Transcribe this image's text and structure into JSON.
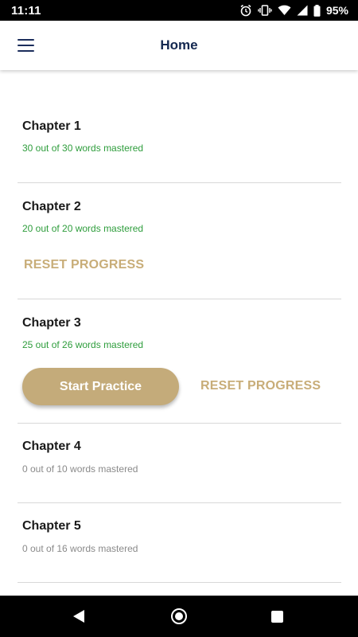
{
  "status_bar": {
    "time": "11:11",
    "battery": "95%"
  },
  "app_bar": {
    "title": "Home"
  },
  "chapters": [
    {
      "title": "Chapter 1",
      "subtitle": "30 out of 30 words mastered"
    },
    {
      "title": "Chapter 2",
      "subtitle": "20 out of 20 words mastered",
      "reset_label": "RESET PROGRESS"
    },
    {
      "title": "Chapter 3",
      "subtitle": "25 out of 26 words mastered",
      "start_label": "Start Practice",
      "reset_label": "RESET PROGRESS"
    },
    {
      "title": "Chapter 4",
      "subtitle": "0 out of 10 words mastered"
    },
    {
      "title": "Chapter 5",
      "subtitle": "0 out of 16 words mastered"
    }
  ],
  "colors": {
    "accent_gold": "#c4ab7a",
    "mastered_green": "#2e9d3c",
    "title_navy": "#142850"
  }
}
